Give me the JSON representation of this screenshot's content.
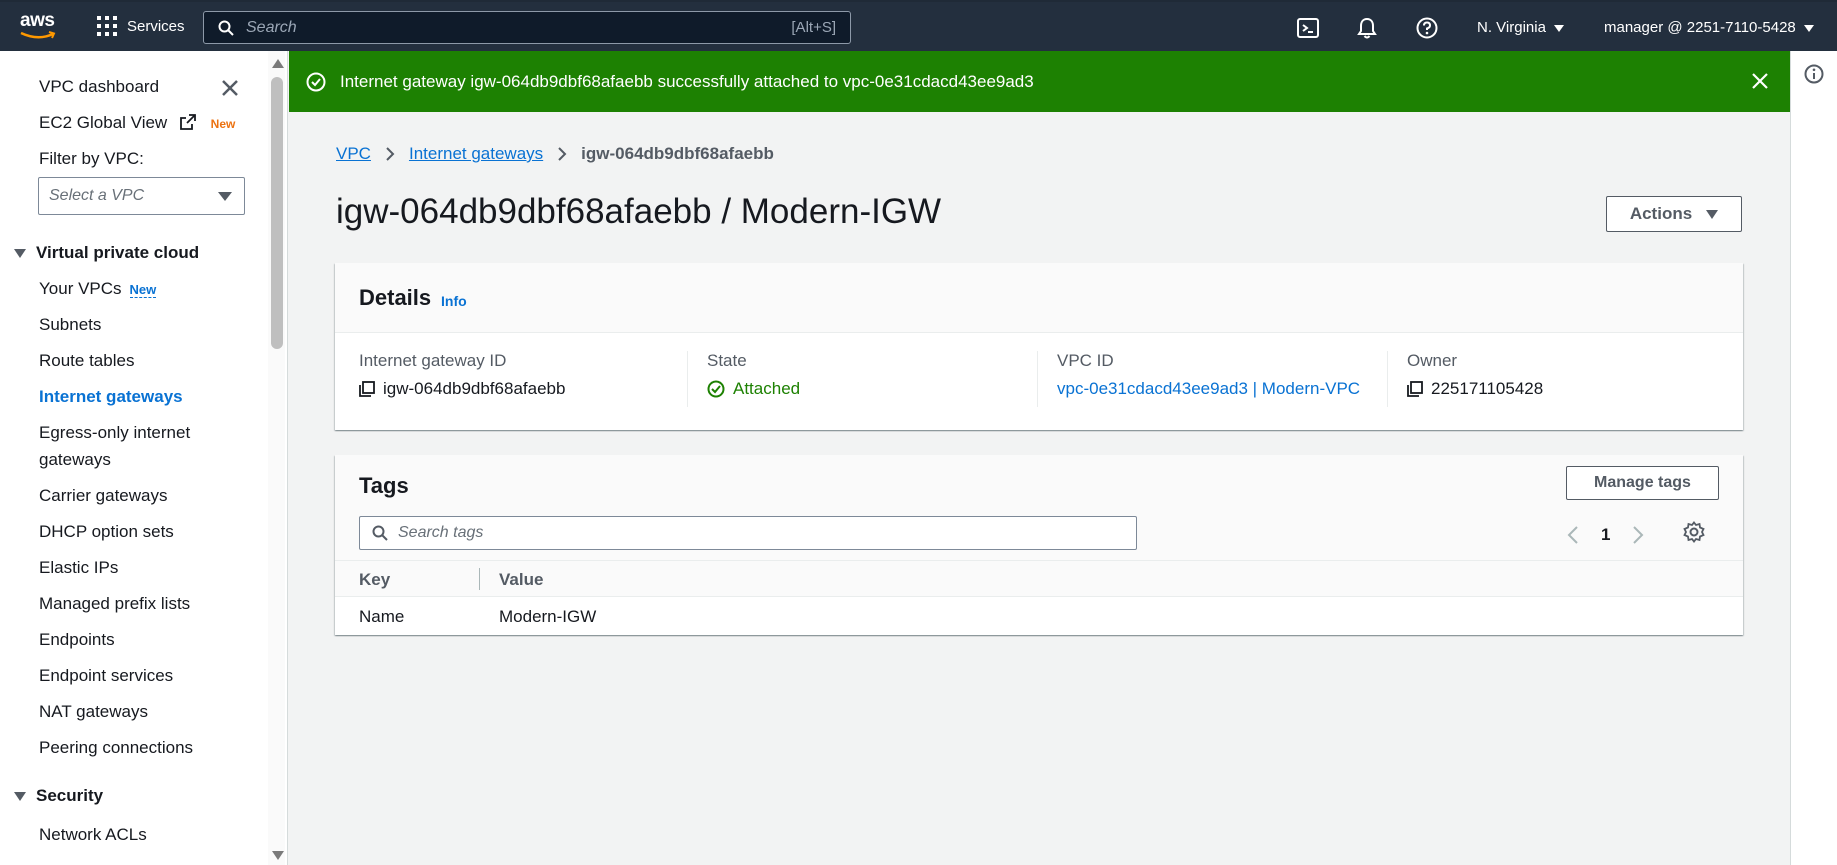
{
  "topnav": {
    "logo": "aws",
    "services_label": "Services",
    "search_placeholder": "Search",
    "search_hint": "[Alt+S]",
    "region": "N. Virginia",
    "account": "manager @ 2251-7110-5428",
    "icons": [
      "cloudshell-icon",
      "bell-icon",
      "help-icon"
    ]
  },
  "sidebar": {
    "dashboard": "VPC dashboard",
    "ec2_global": "EC2 Global View",
    "ec2_new": "New",
    "filter_label": "Filter by VPC:",
    "filter_placeholder": "Select a VPC",
    "section_vpc": "Virtual private cloud",
    "items": [
      {
        "label": "Your VPCs",
        "badge": "New"
      },
      {
        "label": "Subnets"
      },
      {
        "label": "Route tables"
      },
      {
        "label": "Internet gateways",
        "active": true
      },
      {
        "label": "Egress-only internet gateways"
      },
      {
        "label": "Carrier gateways"
      },
      {
        "label": "DHCP option sets"
      },
      {
        "label": "Elastic IPs"
      },
      {
        "label": "Managed prefix lists"
      },
      {
        "label": "Endpoints"
      },
      {
        "label": "Endpoint services"
      },
      {
        "label": "NAT gateways"
      },
      {
        "label": "Peering connections"
      }
    ],
    "section_security": "Security",
    "security_items": [
      {
        "label": "Network ACLs"
      }
    ]
  },
  "flash": {
    "message": "Internet gateway igw-064db9dbf68afaebb successfully attached to vpc-0e31cdacd43ee9ad3",
    "color": "#1d8102"
  },
  "breadcrumb": {
    "root": "VPC",
    "parent": "Internet gateways",
    "current": "igw-064db9dbf68afaebb"
  },
  "page": {
    "title": "igw-064db9dbf68afaebb / Modern-IGW",
    "actions_label": "Actions"
  },
  "details": {
    "heading": "Details",
    "info": "Info",
    "fields": {
      "igw_id_label": "Internet gateway ID",
      "igw_id_value": "igw-064db9dbf68afaebb",
      "state_label": "State",
      "state_value": "Attached",
      "vpc_label": "VPC ID",
      "vpc_value": "vpc-0e31cdacd43ee9ad3 | Modern-VPC",
      "owner_label": "Owner",
      "owner_value": "225171105428"
    }
  },
  "tags": {
    "heading": "Tags",
    "manage_label": "Manage tags",
    "search_placeholder": "Search tags",
    "page": "1",
    "columns": [
      "Key",
      "Value"
    ],
    "rows": [
      {
        "key": "Name",
        "value": "Modern-IGW"
      }
    ]
  },
  "colors": {
    "nav_bg": "#232f3e",
    "link": "#0972d3",
    "success": "#1d8102"
  }
}
